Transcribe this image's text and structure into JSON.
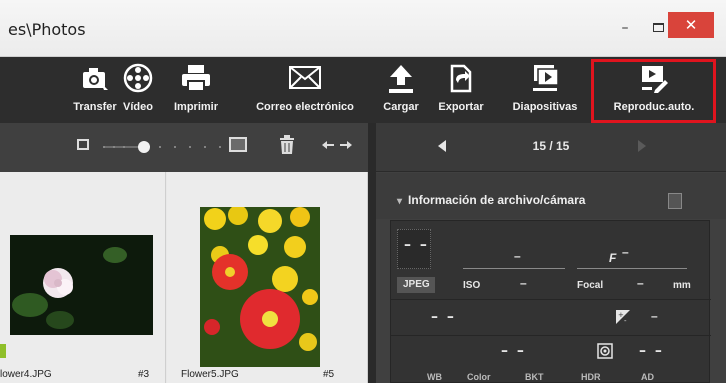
{
  "window": {
    "title": "es\\Photos",
    "minimize_glyph": "–",
    "close_glyph": "✕"
  },
  "toolbar": {
    "items": [
      {
        "label": "Transfer",
        "icon": "camera-transfer-icon"
      },
      {
        "label": "Vídeo",
        "icon": "film-reel-icon"
      },
      {
        "label": "Imprimir",
        "icon": "printer-icon"
      },
      {
        "label": "Correo electrónico",
        "icon": "envelope-icon"
      },
      {
        "label": "Cargar",
        "icon": "upload-icon"
      },
      {
        "label": "Exportar",
        "icon": "export-icon"
      },
      {
        "label": "Diapositivas",
        "icon": "slideshow-icon"
      },
      {
        "label": "Reproduc.auto.",
        "icon": "autoplay-icon"
      }
    ],
    "highlight_color": "#e0141e"
  },
  "thumbnails": [
    {
      "filename": "lower4.JPG",
      "number": "#3"
    },
    {
      "filename": "Flower5.JPG",
      "number": "#5"
    }
  ],
  "viewer": {
    "counter": "15 / 15"
  },
  "info_panel": {
    "title": "Información de archivo/cámara",
    "placeholder_short": "–",
    "placeholder_double": "– –",
    "f_label": "F",
    "format": "JPEG",
    "iso_label": "ISO",
    "focal_label": "Focal",
    "mm_unit": "mm",
    "bottom_labels": [
      "WB",
      "Color",
      "BKT",
      "HDR",
      "AD"
    ]
  }
}
